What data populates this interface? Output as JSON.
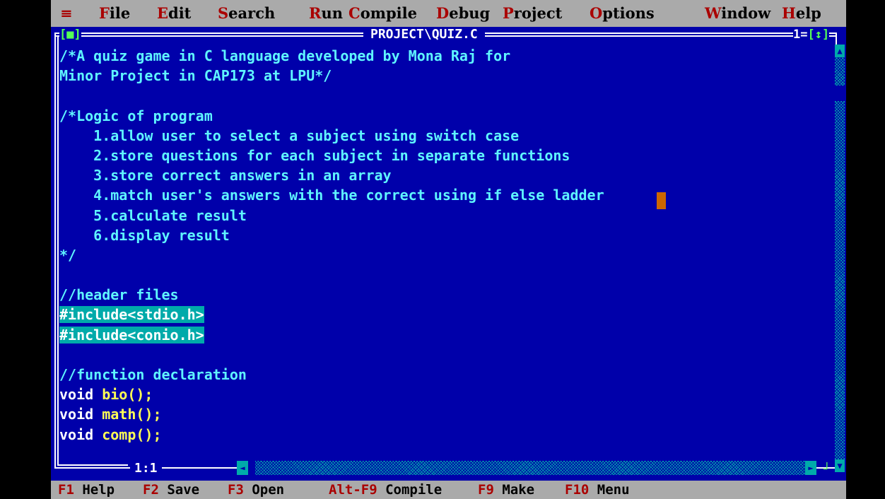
{
  "menu": {
    "system": "≡",
    "items": [
      {
        "hot": "F",
        "rest": "ile"
      },
      {
        "hot": "E",
        "rest": "dit"
      },
      {
        "hot": "S",
        "rest": "earch"
      },
      {
        "hot": "R",
        "rest": "un"
      },
      {
        "hot": "C",
        "rest": "ompile"
      },
      {
        "hot": "D",
        "rest": "ebug"
      },
      {
        "hot": "P",
        "rest": "roject"
      },
      {
        "hot": "O",
        "rest": "ptions"
      },
      {
        "hot": "W",
        "rest": "indow"
      },
      {
        "hot": "H",
        "rest": "elp"
      }
    ]
  },
  "editor": {
    "title": "PROJECT\\QUIZ.C",
    "close_box": "[■]",
    "window_number": "1",
    "zoom_box": "[↕]",
    "position": "1:1",
    "lines": [
      [
        {
          "t": "/*A quiz game in C language developed by Mona Raj for",
          "c": "cmt"
        }
      ],
      [
        {
          "t": "Minor Project in CAP173 at LPU*/",
          "c": "cmt"
        }
      ],
      [
        {
          "t": "",
          "c": "cmt"
        }
      ],
      [
        {
          "t": "/*Logic of program",
          "c": "cmt"
        }
      ],
      [
        {
          "t": "    1.allow user to select a subject using switch case",
          "c": "cmt"
        }
      ],
      [
        {
          "t": "    2.store questions for each subject in separate functions",
          "c": "cmt"
        }
      ],
      [
        {
          "t": "    3.store correct answers in an array",
          "c": "cmt"
        }
      ],
      [
        {
          "t": "    4.match user's answers with the correct using if else ladder",
          "c": "cmt"
        }
      ],
      [
        {
          "t": "    5.calculate result",
          "c": "cmt"
        }
      ],
      [
        {
          "t": "    6.display result",
          "c": "cmt"
        }
      ],
      [
        {
          "t": "*/",
          "c": "cmt"
        }
      ],
      [
        {
          "t": "",
          "c": "cmt"
        }
      ],
      [
        {
          "t": "//header files",
          "c": "cmt"
        }
      ],
      [
        {
          "t": "#include<stdio.h>",
          "c": "sel"
        }
      ],
      [
        {
          "t": "#include<conio.h>",
          "c": "sel"
        }
      ],
      [
        {
          "t": "",
          "c": "cmt"
        }
      ],
      [
        {
          "t": "//function declaration",
          "c": "cmt"
        }
      ],
      [
        {
          "t": "void ",
          "c": "kw"
        },
        {
          "t": "bio",
          "c": "fn"
        },
        {
          "t": "();",
          "c": "fn"
        }
      ],
      [
        {
          "t": "void ",
          "c": "kw"
        },
        {
          "t": "math",
          "c": "fn"
        },
        {
          "t": "();",
          "c": "fn"
        }
      ],
      [
        {
          "t": "void ",
          "c": "kw"
        },
        {
          "t": "comp",
          "c": "fn"
        },
        {
          "t": "();",
          "c": "fn"
        }
      ]
    ]
  },
  "status": [
    {
      "key": "F1",
      "label": "Help"
    },
    {
      "key": "F2",
      "label": "Save"
    },
    {
      "key": "F3",
      "label": "Open"
    },
    {
      "key": "Alt-F9",
      "label": "Compile"
    },
    {
      "key": "F9",
      "label": "Make"
    },
    {
      "key": "F10",
      "label": "Menu"
    }
  ],
  "colors": {
    "background": "#0000aa",
    "menu_bar": "#aaaaaa",
    "hotkey": "#aa0000",
    "comment": "#5ff5ff",
    "selection": "#00aaaa",
    "identifier": "#ffff55",
    "cursor": "#cc6600"
  }
}
